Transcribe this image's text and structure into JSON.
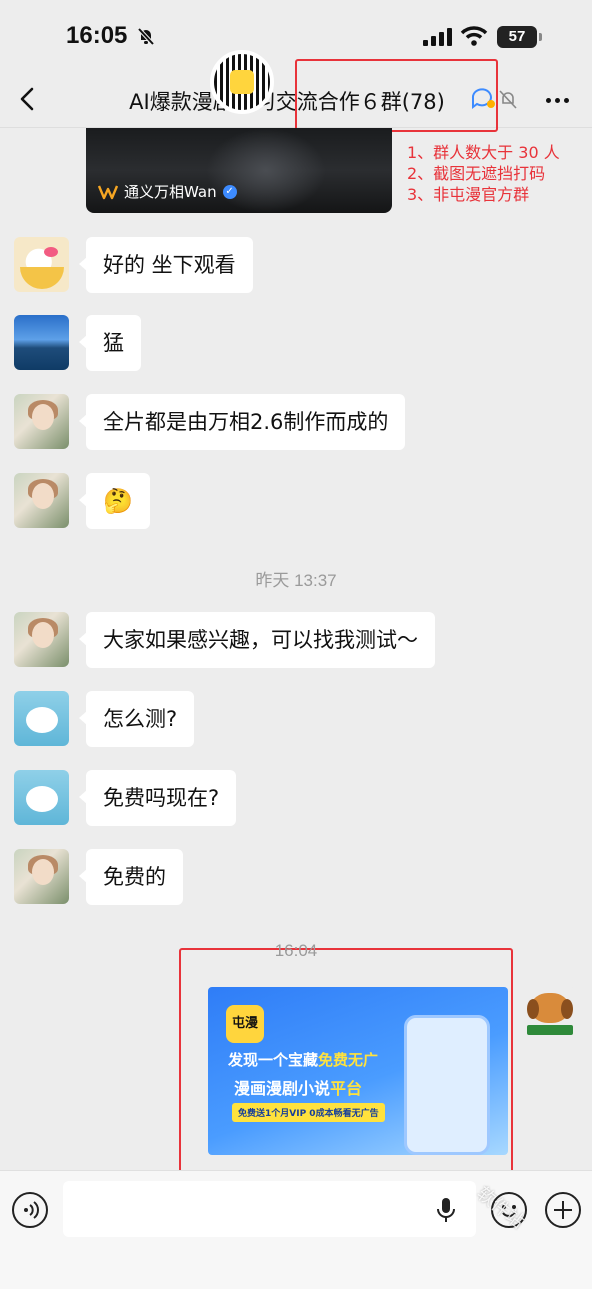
{
  "status_bar": {
    "time": "16:05",
    "battery": "57"
  },
  "nav": {
    "title": "AI爆款漫剧学习交流合作６群(78)"
  },
  "annotation": {
    "lines": [
      "1、群人数大于 30 人",
      "2、截图无遮挡打码",
      "3、非屯漫官方群"
    ],
    "color": "#e8333a"
  },
  "video_card": {
    "source": "通义万相Wan"
  },
  "messages": [
    {
      "text": "好的 坐下观看",
      "avatar": "hello-kitty-avatar"
    },
    {
      "text": "猛",
      "avatar": "lake-avatar"
    },
    {
      "text": "全片都是由万相2.6制作而成的",
      "avatar": "girl-avatar"
    },
    {
      "text": "🤔",
      "avatar": "girl-avatar"
    },
    {
      "text": "大家如果感兴趣，可以找我测试～",
      "avatar": "girl-avatar"
    },
    {
      "text": "怎么测?",
      "avatar": "dog-swim-avatar"
    },
    {
      "text": "免费吗现在?",
      "avatar": "dog-swim-avatar"
    },
    {
      "text": "免费的",
      "avatar": "girl-avatar"
    }
  ],
  "timestamps": {
    "t1": "昨天 13:37",
    "t2": "16:04"
  },
  "ad_card": {
    "logo": "屯漫",
    "line1_a": "发现一个宝藏",
    "line1_b": "免费无广",
    "line2_a": "漫画漫剧小说",
    "line2_b": "平台",
    "line3": "免费送1个月VIP  0成本畅看无广告"
  },
  "watermark": "软件站"
}
